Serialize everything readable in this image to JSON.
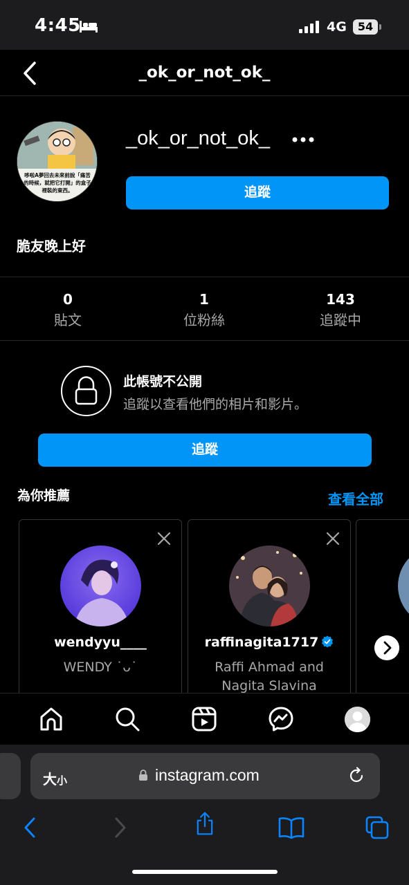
{
  "status_bar": {
    "time": "4:45",
    "network": "4G",
    "battery": "54"
  },
  "nav": {
    "title": "_ok_or_not_ok_"
  },
  "profile": {
    "username": "_ok_or_not_ok_",
    "follow_label": "追蹤",
    "bio": "脆友晚上好",
    "avatar_caption": "哆啦A夢回去未來前說「痛苦的時候，就把它打開」的盒子裡裝的東西。"
  },
  "stats": [
    {
      "value": "0",
      "label": "貼文"
    },
    {
      "value": "1",
      "label": "位粉絲"
    },
    {
      "value": "143",
      "label": "追蹤中"
    }
  ],
  "private": {
    "title": "此帳號不公開",
    "subtitle": "追蹤以查看他們的相片和影片。",
    "follow_label": "追蹤"
  },
  "suggestions": {
    "title": "為你推薦",
    "see_all": "查看全部",
    "cards": [
      {
        "username": "wendyyu____",
        "subtitle": "WENDY ˙ᴗ˙",
        "verified": false
      },
      {
        "username": "raffinagita1717",
        "subtitle": "Raffi Ahmad and Nagita Slavina",
        "verified": true
      }
    ]
  },
  "browser": {
    "aa_big": "大",
    "aa_small": "小",
    "url": "instagram.com"
  },
  "colors": {
    "accent": "#0095f6",
    "background": "#000000",
    "secondary_text": "#a8a8a8"
  }
}
